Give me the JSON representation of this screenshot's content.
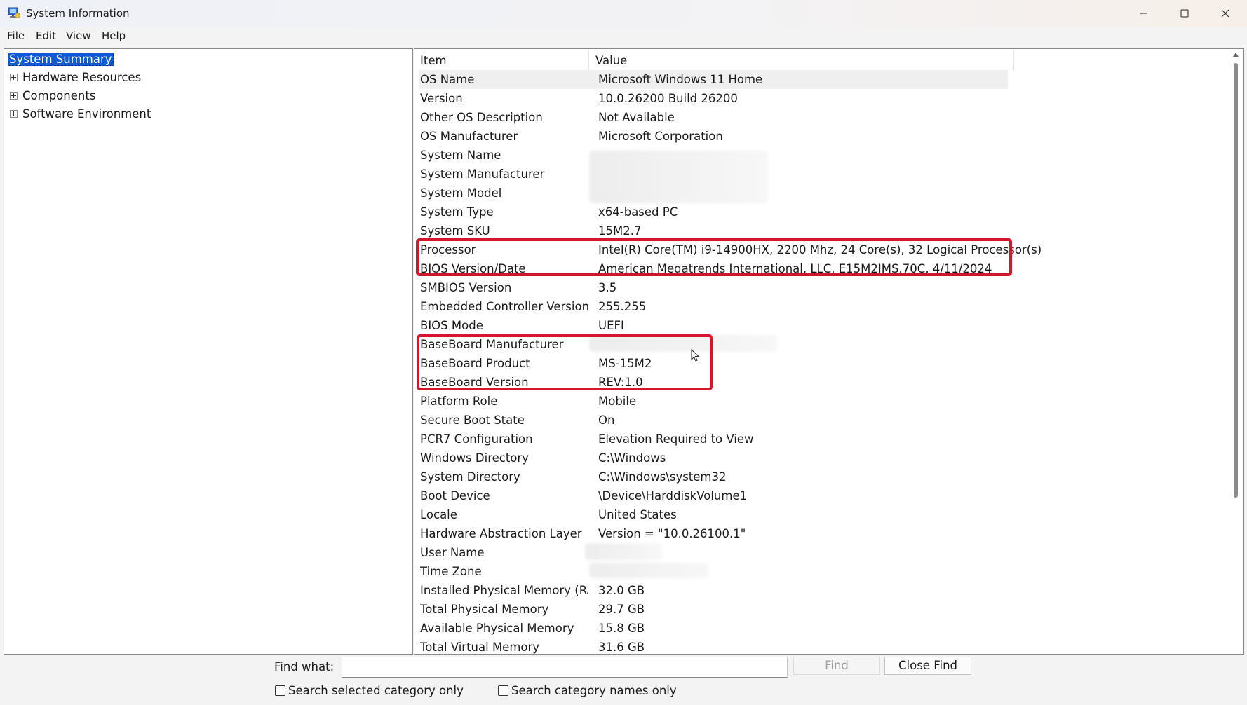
{
  "window": {
    "title": "System Information",
    "icon": "system-info-icon",
    "controls": [
      "minimize-icon",
      "maximize-icon",
      "close-icon"
    ]
  },
  "menu": [
    "File",
    "Edit",
    "View",
    "Help"
  ],
  "tree": {
    "selected": "System Summary",
    "items": [
      "Hardware Resources",
      "Components",
      "Software Environment"
    ]
  },
  "list": {
    "columns": [
      "Item",
      "Value"
    ],
    "rows": [
      {
        "item": "OS Name",
        "value": "Microsoft Windows 11 Home"
      },
      {
        "item": "Version",
        "value": "10.0.26200 Build 26200"
      },
      {
        "item": "Other OS Description",
        "value": "Not Available"
      },
      {
        "item": "OS Manufacturer",
        "value": "Microsoft Corporation"
      },
      {
        "item": "System Name",
        "value": ""
      },
      {
        "item": "System Manufacturer",
        "value": ""
      },
      {
        "item": "System Model",
        "value": ""
      },
      {
        "item": "System Type",
        "value": "x64-based PC"
      },
      {
        "item": "System SKU",
        "value": "15M2.7"
      },
      {
        "item": "Processor",
        "value": "Intel(R) Core(TM) i9-14900HX, 2200 Mhz, 24 Core(s), 32 Logical Processor(s)"
      },
      {
        "item": "BIOS Version/Date",
        "value": "American Megatrends International, LLC. E15M2IMS.70C, 4/11/2024"
      },
      {
        "item": "SMBIOS Version",
        "value": "3.5"
      },
      {
        "item": "Embedded Controller Version",
        "value": "255.255"
      },
      {
        "item": "BIOS Mode",
        "value": "UEFI"
      },
      {
        "item": "BaseBoard Manufacturer",
        "value": ""
      },
      {
        "item": "BaseBoard Product",
        "value": "MS-15M2"
      },
      {
        "item": "BaseBoard Version",
        "value": "REV:1.0"
      },
      {
        "item": "Platform Role",
        "value": "Mobile"
      },
      {
        "item": "Secure Boot State",
        "value": "On"
      },
      {
        "item": "PCR7 Configuration",
        "value": "Elevation Required to View"
      },
      {
        "item": "Windows Directory",
        "value": "C:\\Windows"
      },
      {
        "item": "System Directory",
        "value": "C:\\Windows\\system32"
      },
      {
        "item": "Boot Device",
        "value": "\\Device\\HarddiskVolume1"
      },
      {
        "item": "Locale",
        "value": "United States"
      },
      {
        "item": "Hardware Abstraction Layer",
        "value": "Version = \"10.0.26100.1\""
      },
      {
        "item": "User Name",
        "value": ""
      },
      {
        "item": "Time Zone",
        "value": ""
      },
      {
        "item": "Installed Physical Memory (RA...",
        "value": "32.0 GB"
      },
      {
        "item": "Total Physical Memory",
        "value": "29.7 GB"
      },
      {
        "item": "Available Physical Memory",
        "value": "15.8 GB"
      },
      {
        "item": "Total Virtual Memory",
        "value": "31.6 GB"
      }
    ]
  },
  "find": {
    "label": "Find what:",
    "value": "",
    "find_button": "Find",
    "close_button": "Close Find",
    "option_selected_only": "Search selected category only",
    "option_names_only": "Search category names only"
  },
  "colors": {
    "selection": "#0b5cd0",
    "highlight_box": "#d3162a"
  }
}
